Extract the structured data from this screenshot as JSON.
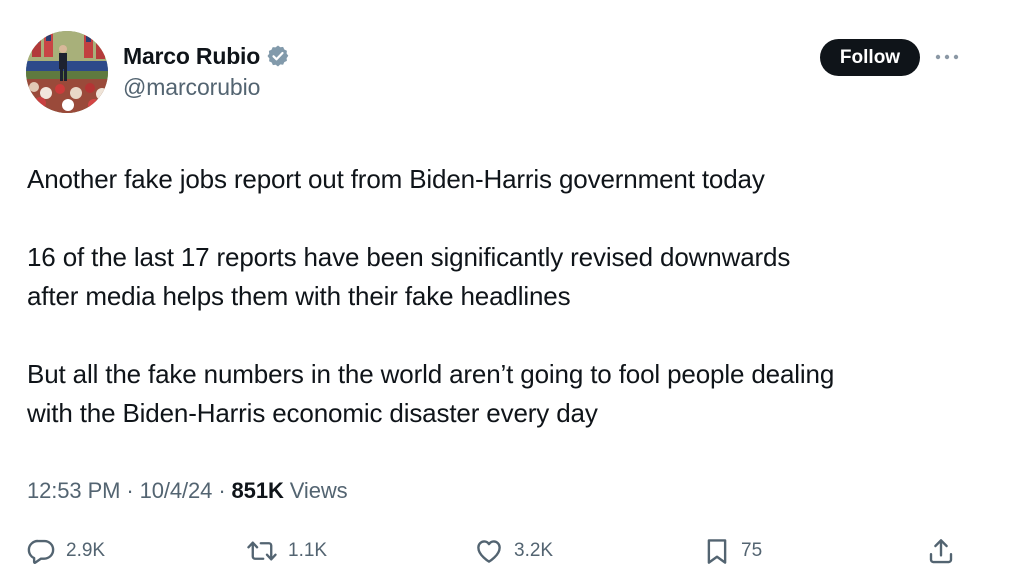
{
  "author": {
    "display_name": "Marco Rubio",
    "handle": "@marcorubio",
    "verified": true
  },
  "follow_label": "Follow",
  "tweet": {
    "paragraphs": [
      "Another fake jobs report out from Biden-Harris government today",
      "16 of the last 17 reports have been significantly revised  downwards\nafter media helps them with their fake headlines",
      "But all the fake numbers in the world aren’t going to fool people dealing\nwith the Biden-Harris economic disaster every day"
    ]
  },
  "meta": {
    "time": "12:53 PM",
    "separator": "·",
    "date": "10/4/24",
    "views_count": "851K",
    "views_label": "Views"
  },
  "actions": {
    "replies": "2.9K",
    "reposts": "1.1K",
    "likes": "3.2K",
    "bookmarks": "75"
  },
  "colors": {
    "text": "#0f1419",
    "secondary": "#536471",
    "verified": "#829aab",
    "follow_bg": "#0f1419"
  }
}
